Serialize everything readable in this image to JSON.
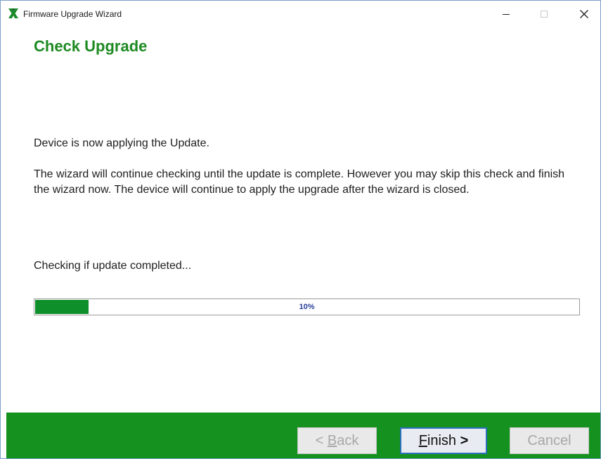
{
  "window": {
    "title": "Firmware Upgrade Wizard",
    "minimize_glyph": "–",
    "maximize_glyph": "□",
    "close_glyph": "✕"
  },
  "page": {
    "title": "Check Upgrade",
    "status_line": "Device is now applying the Update.",
    "info_paragraph": "The wizard will continue checking until the update is complete.  However you may skip this check and finish the wizard now.  The device will continue to apply the upgrade after the wizard is closed.",
    "checking_line": "Checking if update completed..."
  },
  "progress": {
    "percent": 10,
    "label": "10%"
  },
  "buttons": {
    "back": {
      "arrow": "<",
      "mnemonic": "B",
      "rest": "ack",
      "enabled": false
    },
    "finish": {
      "mnemonic": "F",
      "rest": "inish",
      "arrow": ">",
      "enabled": true
    },
    "cancel": {
      "label": "Cancel",
      "enabled": false
    }
  },
  "colors": {
    "accent_green": "#1e8a22",
    "footer_green": "#14911e",
    "progress_green": "#0f8f2a",
    "progress_text": "#2b3f9a",
    "focus_border": "#2d6fc0"
  },
  "icons": {
    "app": "x-logo-icon",
    "minimize": "minimize-icon",
    "maximize": "maximize-icon",
    "close": "close-icon"
  }
}
